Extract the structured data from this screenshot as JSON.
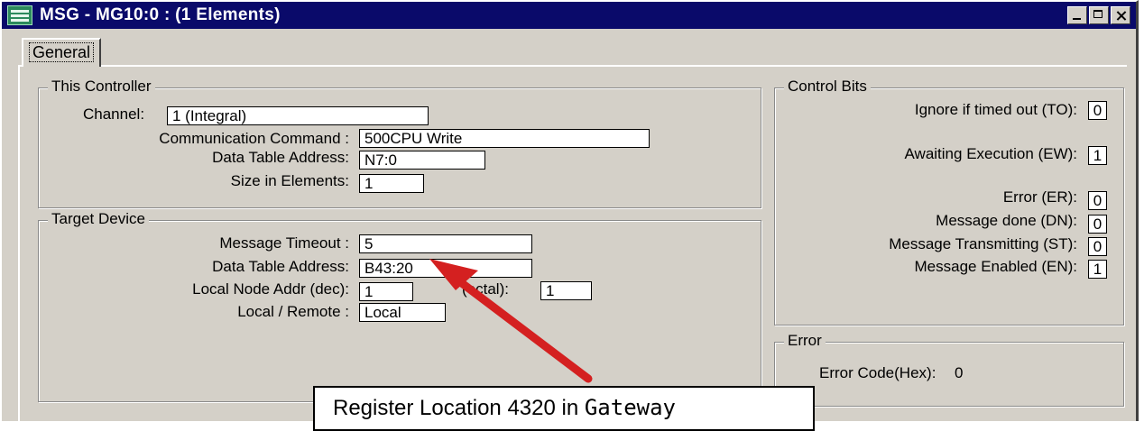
{
  "window": {
    "title": "MSG - MG10:0 : (1 Elements)",
    "tab_label": "General"
  },
  "this_controller": {
    "group_title": "This Controller",
    "channel_label": "Channel:",
    "channel_value": "1 (Integral)",
    "comm_command_label": "Communication Command :",
    "comm_command_value": "500CPU Write",
    "data_table_label": "Data Table Address:",
    "data_table_value": "N7:0",
    "size_label": "Size in Elements:",
    "size_value": "1"
  },
  "target_device": {
    "group_title": "Target Device",
    "timeout_label": "Message Timeout :",
    "timeout_value": "5",
    "data_table_label": "Data Table Address:",
    "data_table_value": "B43:20",
    "local_node_label": "Local Node Addr (dec):",
    "local_node_value": "1",
    "octal_label": "(octal):",
    "octal_value": "1",
    "local_remote_label": "Local / Remote :",
    "local_remote_value": "Local"
  },
  "control_bits": {
    "group_title": "Control Bits",
    "to_label": "Ignore if timed out (TO):",
    "to_value": "0",
    "ew_label": "Awaiting Execution (EW):",
    "ew_value": "1",
    "er_label": "Error (ER):",
    "er_value": "0",
    "dn_label": "Message done (DN):",
    "dn_value": "0",
    "st_label": "Message Transmitting (ST):",
    "st_value": "0",
    "en_label": "Message Enabled (EN):",
    "en_value": "1"
  },
  "error_group": {
    "group_title": "Error",
    "code_label": "Error Code(Hex):",
    "code_value": "0"
  },
  "callout": {
    "text": "Register Location 4320 in",
    "mono_text": "Gateway"
  },
  "colors": {
    "titlebar": "#0a0a6a",
    "dialog_bg": "#d4d0c8",
    "arrow": "#d42020"
  }
}
